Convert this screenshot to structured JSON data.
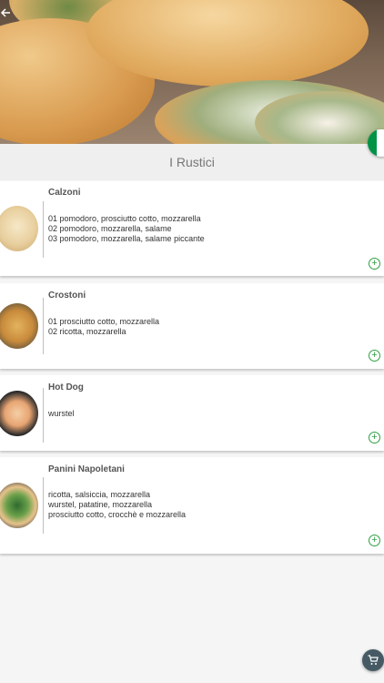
{
  "header": {
    "back_icon": "arrow-left-icon",
    "language_flag": {
      "icon": "italy-flag-icon",
      "colors": [
        "#009246",
        "#ffffff",
        "#ce2b37"
      ]
    }
  },
  "category": {
    "title": "I Rustici"
  },
  "products": [
    {
      "name": "Calzoni",
      "options": [
        "01 pomodoro, prosciutto cotto, mozzarella",
        "02 pomodoro, mozzarella, salame",
        "03 pomodoro, mozzarella, salame piccante"
      ],
      "add_icon": "add-circle-icon"
    },
    {
      "name": "Crostoni",
      "options": [
        "01 prosciutto cotto, mozzarella",
        "02 ricotta, mozzarella"
      ],
      "add_icon": "add-circle-icon"
    },
    {
      "name": "Hot Dog",
      "options": [
        "wurstel"
      ],
      "add_icon": "add-circle-icon"
    },
    {
      "name": "Panini Napoletani",
      "options": [
        "ricotta, salsiccia, mozzarella",
        "wurstel, patatine, mozzarella",
        "prosciutto cotto, crocchè e mozzarella"
      ],
      "add_icon": "add-circle-icon"
    }
  ],
  "cart": {
    "icon": "cart-icon"
  },
  "colors": {
    "accent": "#2ea043",
    "cart_button": "#455a64"
  }
}
